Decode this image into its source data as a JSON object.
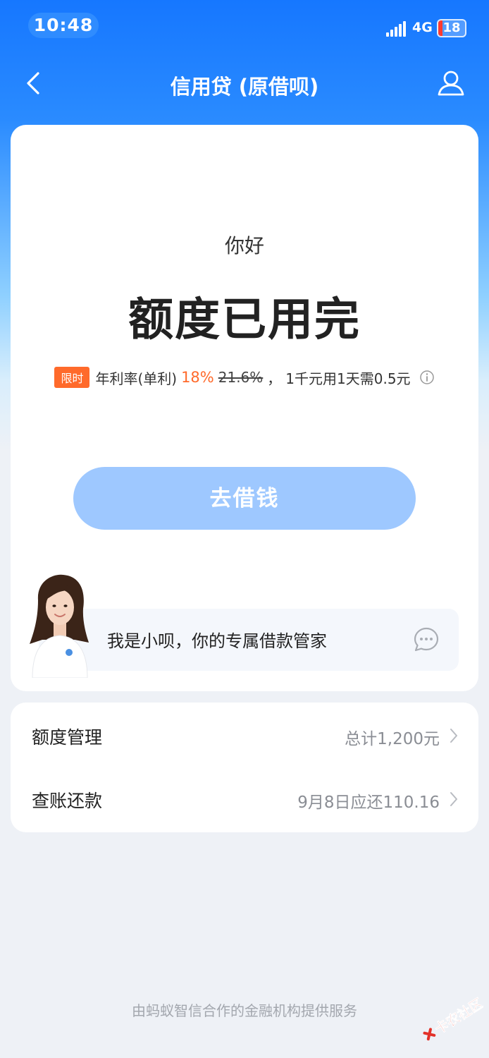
{
  "status_bar": {
    "time": "10:48",
    "network": "4G",
    "battery": "18",
    "colors": {
      "pill": "#2f8cff",
      "battery_low": "#ff3b30"
    }
  },
  "nav": {
    "title": "信用贷 (原借呗)",
    "back_icon": "chevron-left-icon",
    "user_icon": "user-icon"
  },
  "main": {
    "greeting": "你好",
    "headline": "额度已用完",
    "rate": {
      "tag": "限时",
      "label": "年利率(单利)",
      "new_rate": "18%",
      "old_rate": "21.6%",
      "separator": "，",
      "cost_text": "1千元用1天需0.5元",
      "info_icon": "info-icon"
    },
    "borrow_button": "去借钱",
    "assistant": {
      "text": "我是小呗，你的专属借款管家",
      "chat_icon": "chat-bubble-icon"
    }
  },
  "list": [
    {
      "label": "额度管理",
      "value": "总计1,200元"
    },
    {
      "label": "查账还款",
      "value": "9月8日应还110.16"
    }
  ],
  "footer": "由蚂蚁智信合作的金融机构提供服务",
  "watermark": "卡农社区",
  "colors": {
    "brand_blue": "#1677ff",
    "button_disabled": "#9ec8ff",
    "accent_orange": "#ff6a2b",
    "page_bg": "#eef1f6"
  }
}
